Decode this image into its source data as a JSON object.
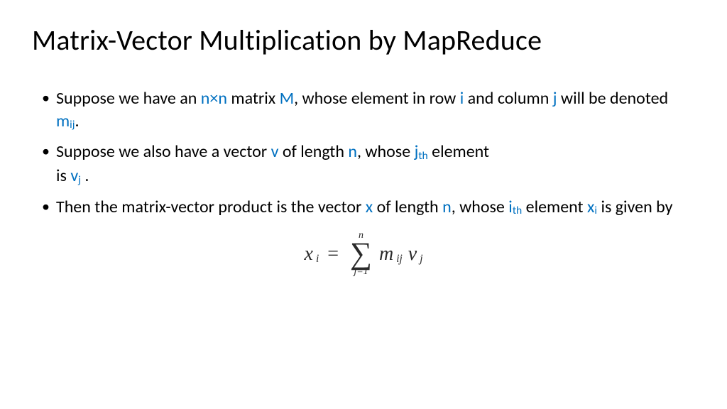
{
  "title": "Matrix-Vector Multiplication by MapReduce",
  "bullets": {
    "b1": {
      "t1": "Suppose we have an ",
      "nxn": "n×n",
      "t2": " matrix ",
      "M": "M",
      "t3": ", whose element in row ",
      "i": "i",
      "t4": " and column ",
      "j": "j",
      "t5": " will be denoted ",
      "m": "m",
      "ij": "ij",
      "t6": "."
    },
    "b2": {
      "t1": "Suppose we also have a vector ",
      "v": "v",
      "t2": " of length ",
      "n": "n",
      "t3": ", whose ",
      "j": "j",
      "th": "th",
      "t4": " element",
      "t5": "is ",
      "v2": "v",
      "jsub": "j",
      "t6": " ."
    },
    "b3": {
      "t1": "Then the matrix-vector product is the vector ",
      "x": "x",
      "t2": " of length ",
      "n": "n",
      "t3": ", whose ",
      "i": "i",
      "th": "th",
      "t4": " element ",
      "x2": "x",
      "isub": "i",
      "t5": " is given by"
    }
  },
  "formula": {
    "lhs_x": "x",
    "lhs_i": "i",
    "eq": "=",
    "sum_top": "n",
    "sigma": "∑",
    "sum_bot": "j=1",
    "m": "m",
    "ij": "ij",
    "v": "v",
    "j": "j"
  }
}
